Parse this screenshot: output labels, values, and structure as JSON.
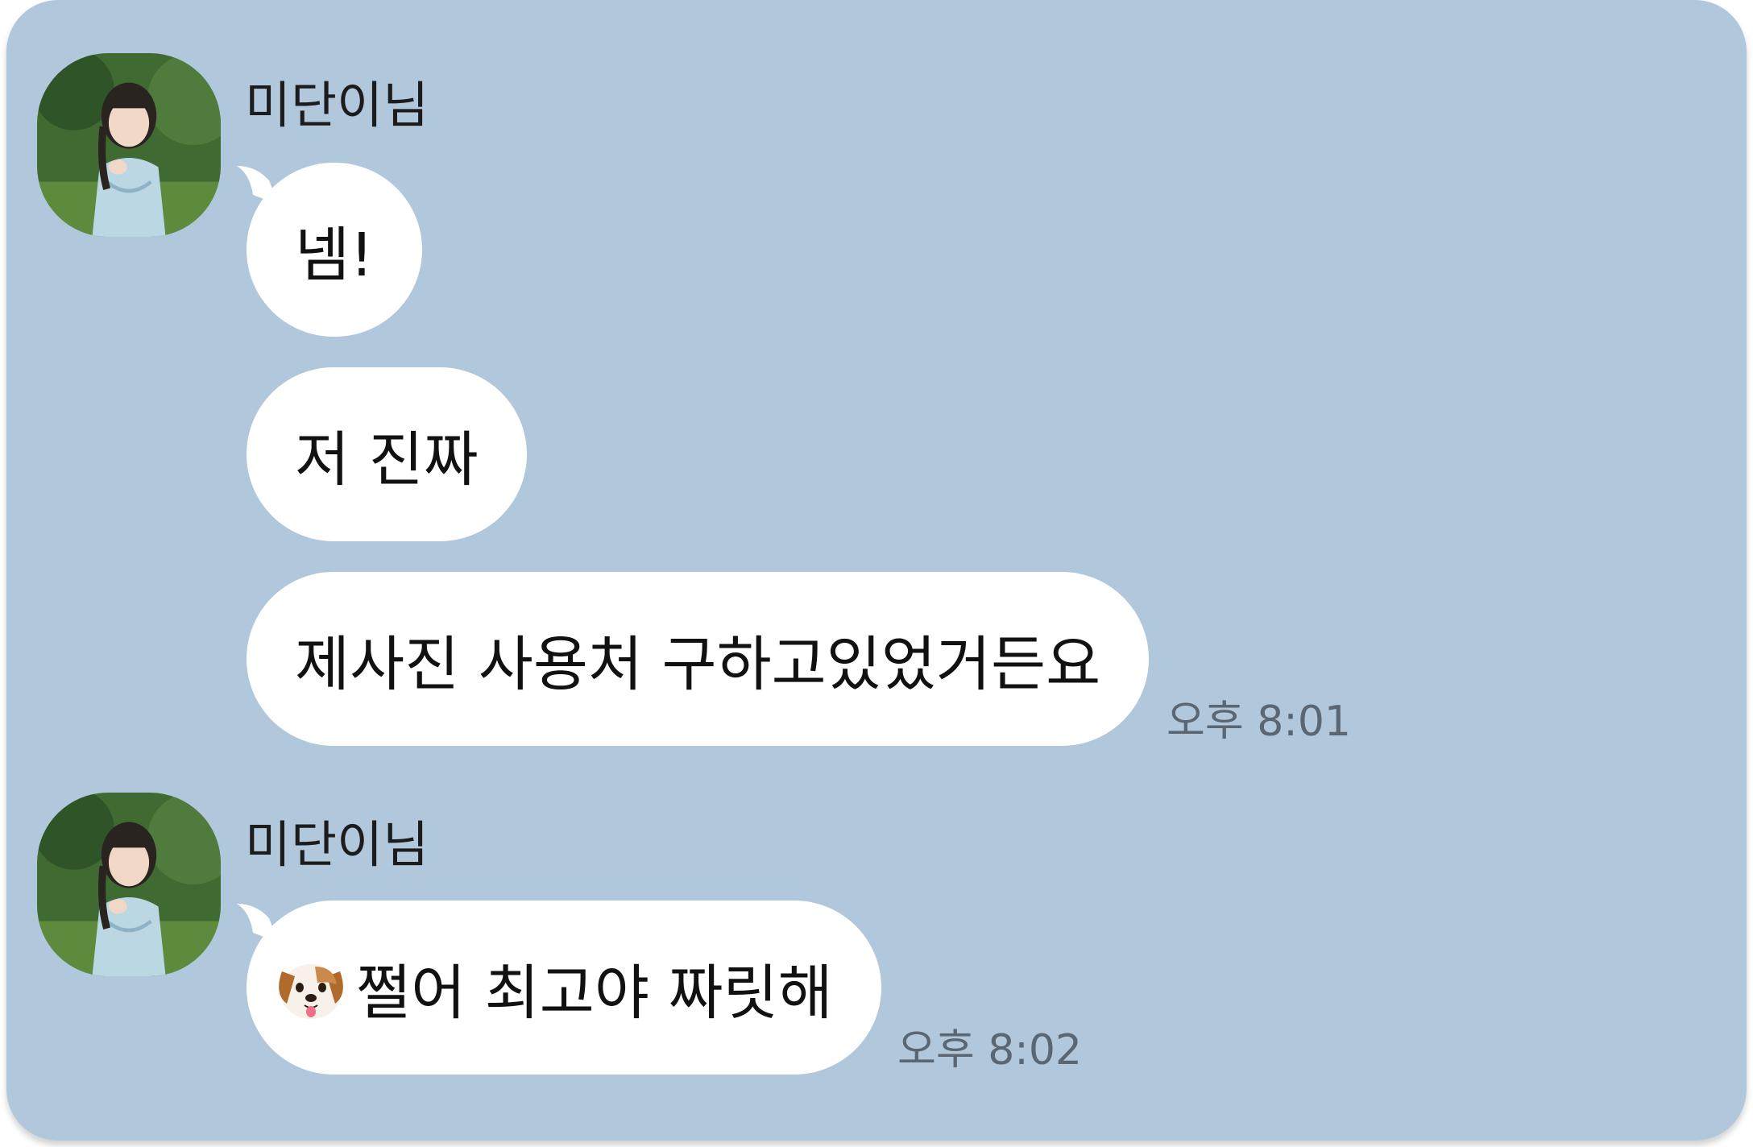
{
  "groups": [
    {
      "sender": "미단이님",
      "avatar_icon": "profile-photo-woman-icon",
      "messages": [
        {
          "text": "넴!"
        },
        {
          "text": "저 진짜"
        },
        {
          "text": "제사진 사용처 구하고있었거든요"
        }
      ],
      "time": "오후 8:01"
    },
    {
      "sender": "미단이님",
      "avatar_icon": "profile-photo-woman-icon",
      "messages": [
        {
          "emoji": "dog-face-icon",
          "text": "쩔어 최고야 짜릿해"
        }
      ],
      "time": "오후 8:02"
    }
  ],
  "colors": {
    "background": "#b0c7dc",
    "bubble": "#ffffff",
    "time_text": "#5a6672"
  }
}
